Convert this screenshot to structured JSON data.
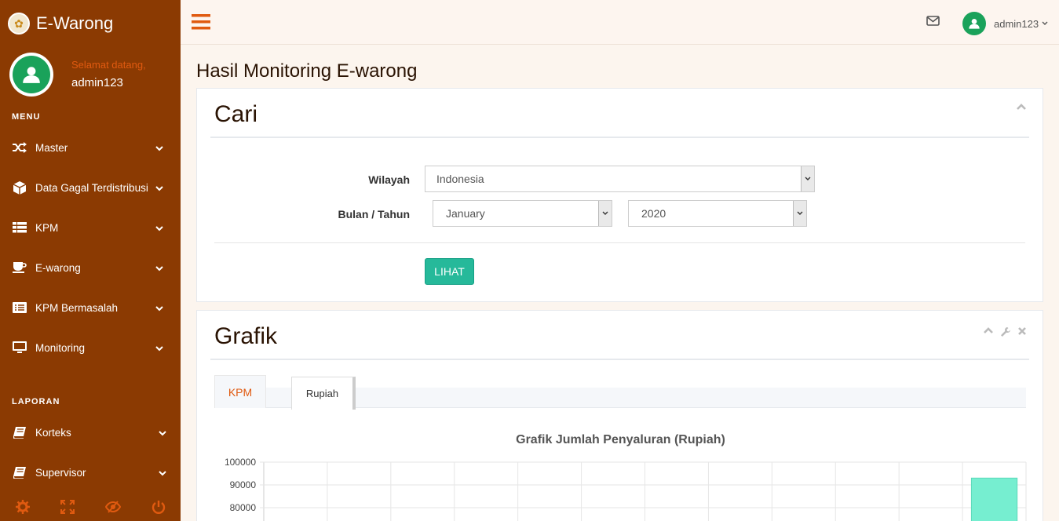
{
  "sidebar": {
    "brand": "E-Warong",
    "welcome": "Selamat datang,",
    "username": "admin123",
    "menu_label": "MENU",
    "menu": [
      {
        "label": "Master",
        "icon": "shuffle-icon"
      },
      {
        "label": "Data Gagal Terdistribusi",
        "icon": "cube-icon"
      },
      {
        "label": "KPM",
        "icon": "table-icon"
      },
      {
        "label": "E-warong",
        "icon": "coffee-icon"
      },
      {
        "label": "KPM Bermasalah",
        "icon": "list-icon"
      },
      {
        "label": "Monitoring",
        "icon": "desktop-icon"
      }
    ],
    "report_label": "LAPORAN",
    "reports": [
      {
        "label": "Korteks",
        "icon": "book-icon"
      },
      {
        "label": "Supervisor",
        "icon": "book-icon"
      }
    ],
    "footer_icons": [
      "settings-icon",
      "fullscreen-icon",
      "eye-slash-icon",
      "power-icon"
    ]
  },
  "topbar": {
    "username": "admin123"
  },
  "page": {
    "title": "Hasil Monitoring E-warong"
  },
  "search_panel": {
    "title": "Cari",
    "wilayah_label": "Wilayah",
    "wilayah_value": "Indonesia",
    "period_label": "Bulan / Tahun",
    "month_value": "January",
    "year_value": "2020",
    "button_label": "LIHAT"
  },
  "chart_panel": {
    "title": "Grafik",
    "tabs": [
      "KPM",
      "Rupiah"
    ],
    "active_tab": "Rupiah"
  },
  "colors": {
    "sidebar": "#8b3a02",
    "accent": "#e05a10",
    "button": "#26b99a",
    "bar": "#76eed0"
  },
  "chart_data": {
    "type": "bar",
    "title": "Grafik Jumlah Penyaluran (Rupiah)",
    "xlabel": "",
    "ylabel": "",
    "y_ticks": [
      100000,
      90000,
      80000
    ],
    "ylim": [
      80000,
      100000
    ],
    "category_count": 12,
    "values": [
      null,
      null,
      null,
      null,
      null,
      null,
      null,
      null,
      null,
      null,
      null,
      93000
    ],
    "grid": true
  }
}
